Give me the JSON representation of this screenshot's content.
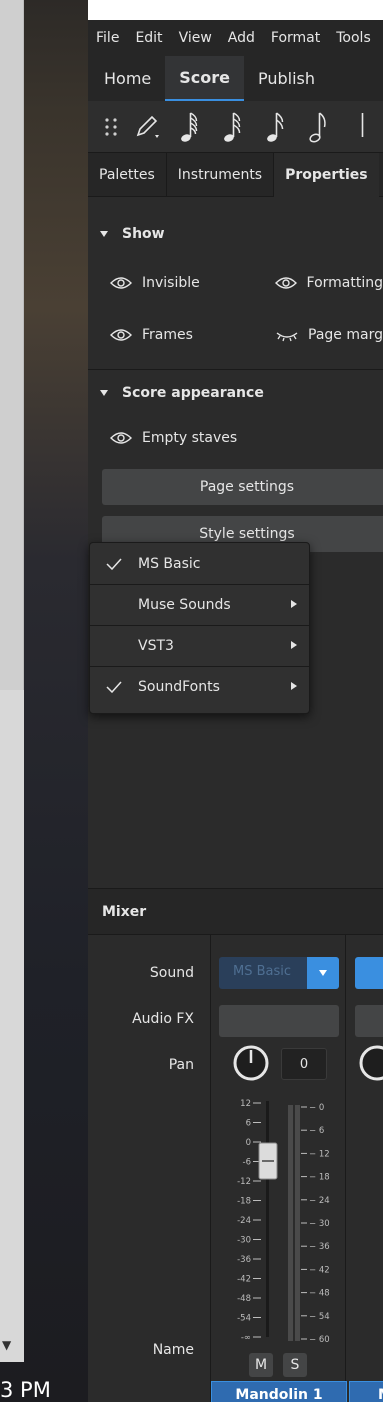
{
  "taskbar": {
    "time_fragment": "3 PM"
  },
  "menubar": {
    "items": [
      "File",
      "Edit",
      "View",
      "Add",
      "Format",
      "Tools"
    ]
  },
  "main_tabs": [
    {
      "label": "Home",
      "active": false
    },
    {
      "label": "Score",
      "active": true
    },
    {
      "label": "Publish",
      "active": false
    }
  ],
  "note_toolbar": {
    "icons": [
      "drag-handle-icon",
      "note-input-pencil-icon",
      "sixty-fourth-note-icon",
      "thirty-second-note-icon",
      "sixteenth-note-icon",
      "eighth-note-icon",
      "quarter-note-icon"
    ]
  },
  "panel_tabs": [
    {
      "label": "Palettes",
      "active": false
    },
    {
      "label": "Instruments",
      "active": false
    },
    {
      "label": "Properties",
      "active": true
    },
    {
      "label": "···",
      "active": false
    }
  ],
  "show_section": {
    "title": "Show",
    "items": [
      {
        "label": "Invisible",
        "icon": "eye-icon"
      },
      {
        "label": "Formatting",
        "icon": "eye-icon"
      },
      {
        "label": "Frames",
        "icon": "eye-icon"
      },
      {
        "label": "Page marg",
        "icon": "eye-closed-icon"
      }
    ]
  },
  "appearance_section": {
    "title": "Score appearance",
    "empty_staves": "Empty staves",
    "page_settings": "Page settings",
    "style_settings": "Style settings"
  },
  "sound_menu": {
    "items": [
      {
        "label": "MS Basic",
        "checked": true,
        "submenu": false
      },
      {
        "label": "Muse Sounds",
        "checked": false,
        "submenu": true
      },
      {
        "label": "VST3",
        "checked": false,
        "submenu": true
      },
      {
        "label": "SoundFonts",
        "checked": true,
        "submenu": true
      }
    ]
  },
  "mixer": {
    "title": "Mixer",
    "row_labels": {
      "sound": "Sound",
      "audio_fx": "Audio FX",
      "pan": "Pan",
      "name": "Name"
    },
    "channel1": {
      "sound": "MS Basic",
      "pan": "0",
      "fader_scale": [
        "12",
        "6",
        "0",
        "-6",
        "-12",
        "-18",
        "-24",
        "-30",
        "-36",
        "-42",
        "-48",
        "-54",
        "-∞"
      ],
      "meter_scale": [
        "0",
        "6",
        "12",
        "18",
        "24",
        "30",
        "36",
        "42",
        "48",
        "54",
        "60"
      ],
      "mute_label": "M",
      "solo_label": "S",
      "name": "Mandolin 1"
    },
    "channel2": {
      "name_fragment": "M"
    }
  },
  "colors": {
    "accent": "#3a8fe0",
    "panel": "#2b2b2b",
    "button": "#444546"
  }
}
